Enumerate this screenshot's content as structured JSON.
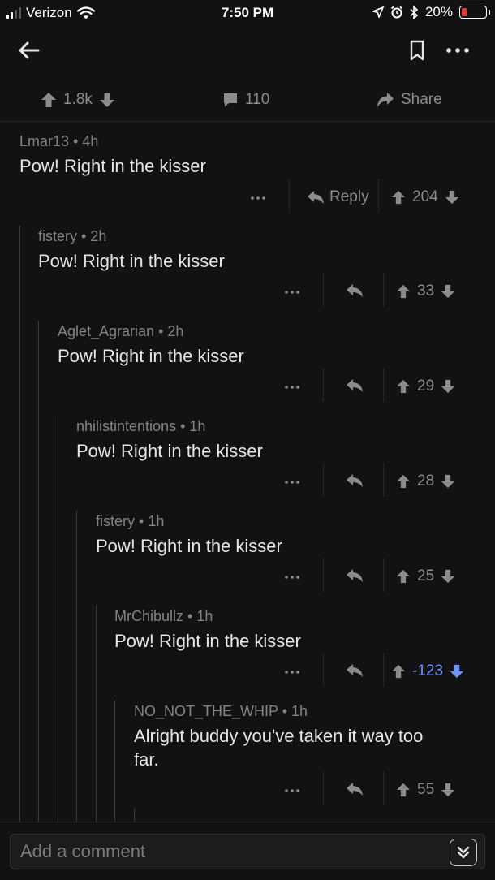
{
  "status_bar": {
    "carrier": "Verizon",
    "time": "7:50 PM",
    "battery": "20%",
    "battery_level": 0.2
  },
  "nav": {
    "back_icon": "arrow-left-icon",
    "bookmark_icon": "bookmark-icon",
    "more_icon": "ellipsis-icon"
  },
  "post_actions": {
    "votes": "1.8k",
    "comments": "110",
    "share_label": "Share"
  },
  "comments": [
    {
      "author": "Lmar13",
      "age": "4h",
      "body": "Pow! Right in the kisser",
      "score": "204",
      "reply_label": "Reply"
    },
    {
      "author": "fistery",
      "age": "2h",
      "body": "Pow! Right in the kisser",
      "score": "33"
    },
    {
      "author": "Aglet_Agrarian",
      "age": "2h",
      "body": "Pow! Right in the kisser",
      "score": "29"
    },
    {
      "author": "nhilistintentions",
      "age": "1h",
      "body": "Pow! Right in the kisser",
      "score": "28"
    },
    {
      "author": "fistery",
      "age": "1h",
      "body": "Pow! Right in the kisser",
      "score": "25"
    },
    {
      "author": "MrChibullz",
      "age": "1h",
      "body": "Pow! Right in the kisser",
      "score": "-123",
      "downvoted": true
    },
    {
      "author": "NO_NOT_THE_WHIP",
      "age": "1h",
      "body": "Alright buddy you've taken it way too far.",
      "score": "55"
    }
  ],
  "comment_bar": {
    "placeholder": "Add a comment"
  },
  "colors": {
    "background": "#121212",
    "downvote": "#7193ff",
    "text": "#e6e6e6",
    "muted": "#818384"
  }
}
